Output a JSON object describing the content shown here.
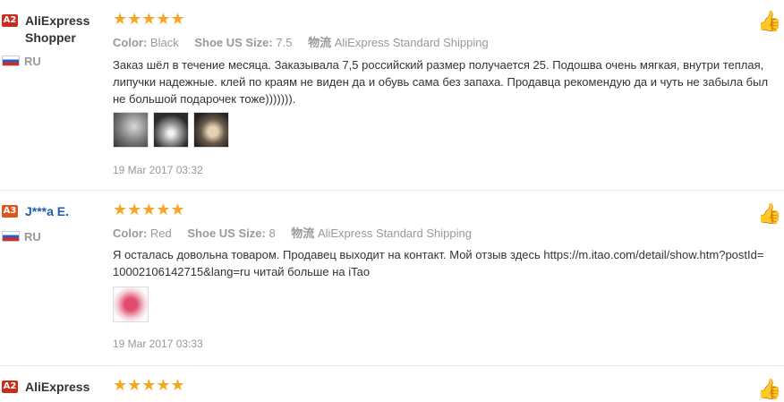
{
  "reviews": [
    {
      "badge": "A2",
      "name": "AliExpress Shopper",
      "country": "RU",
      "stars": "★★★★★",
      "color_label": "Color:",
      "color_value": "Black",
      "size_label": "Shoe US Size:",
      "size_value": "7.5",
      "ship_label": "物流",
      "ship_value": "AliExpress Standard Shipping",
      "text": "Заказ шёл в течение месяца. Заказывала 7,5 российский размер получается 25. Подошва очень мягкая, внутри теплая, липучки надежные. клей по краям не виден да и обувь сама без запаха. Продавца рекомендую да и чуть не забыла был не большой подарочек тоже))))))).",
      "date": "19 Mar 2017 03:32"
    },
    {
      "badge": "A3",
      "name": "J***a E.",
      "country": "RU",
      "stars": "★★★★★",
      "color_label": "Color:",
      "color_value": "Red",
      "size_label": "Shoe US Size:",
      "size_value": "8",
      "ship_label": "物流",
      "ship_value": "AliExpress Standard Shipping",
      "text": "Я осталась довольна товаром. Продавец выходит на контакт. Мой отзыв здесь https://m.itao.com/detail/show.htm?postId=10002106142715&lang=ru читай больше на iTao",
      "date": "19 Mar 2017 03:33"
    },
    {
      "badge": "A2",
      "name": "AliExpress",
      "stars": "★★★★★"
    }
  ],
  "icons": {
    "like": "thumbs-up-icon",
    "flag": "russia-flag-icon",
    "star": "star-icon"
  }
}
